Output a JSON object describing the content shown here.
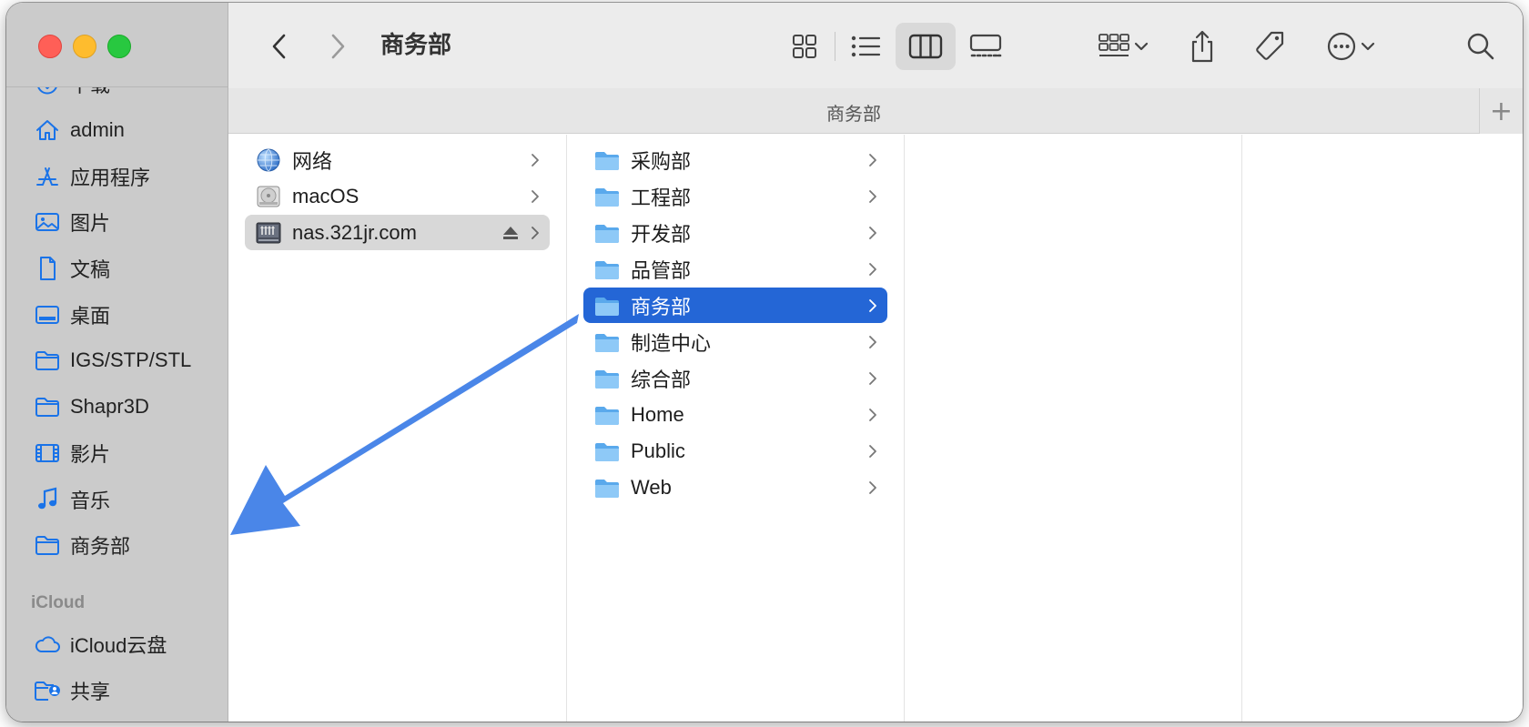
{
  "window": {
    "title": "商务部"
  },
  "toolbar": {
    "back_icon": "chevron-left-icon",
    "forward_icon": "chevron-right-icon",
    "view_modes": [
      "icon-view",
      "list-view",
      "column-view",
      "gallery-view"
    ],
    "active_view": "column-view"
  },
  "pathbar": {
    "title": "商务部",
    "add_label": "+"
  },
  "sidebar": {
    "items": [
      {
        "label": "下载",
        "icon": "download-icon"
      },
      {
        "label": "admin",
        "icon": "home-icon"
      },
      {
        "label": "应用程序",
        "icon": "applications-icon"
      },
      {
        "label": "图片",
        "icon": "pictures-icon"
      },
      {
        "label": "文稿",
        "icon": "document-icon"
      },
      {
        "label": "桌面",
        "icon": "desktop-icon"
      },
      {
        "label": "IGS/STP/STL",
        "icon": "folder-icon"
      },
      {
        "label": "Shapr3D",
        "icon": "folder-icon"
      },
      {
        "label": "影片",
        "icon": "movies-icon"
      },
      {
        "label": "音乐",
        "icon": "music-icon"
      },
      {
        "label": "商务部",
        "icon": "folder-icon"
      }
    ],
    "icloud_heading": "iCloud",
    "icloud_items": [
      {
        "label": "iCloud云盘",
        "icon": "cloud-icon"
      },
      {
        "label": "共享",
        "icon": "shared-folder-icon"
      }
    ]
  },
  "columns": {
    "col1": [
      {
        "label": "网络",
        "icon": "network-icon"
      },
      {
        "label": "macOS",
        "icon": "disk-icon"
      },
      {
        "label": "nas.321jr.com",
        "icon": "server-icon",
        "ejectable": true
      }
    ],
    "col2": [
      {
        "label": "采购部"
      },
      {
        "label": "工程部"
      },
      {
        "label": "开发部"
      },
      {
        "label": "品管部"
      },
      {
        "label": "商务部",
        "selected": true
      },
      {
        "label": "制造中心"
      },
      {
        "label": "综合部"
      },
      {
        "label": "Home"
      },
      {
        "label": "Public"
      },
      {
        "label": "Web"
      }
    ]
  },
  "colors": {
    "selection": "#2466d6",
    "sidebar_bg": "#cbcbcb",
    "accent_icon": "#1a73e8",
    "annotation_arrow": "#4a86e8"
  }
}
